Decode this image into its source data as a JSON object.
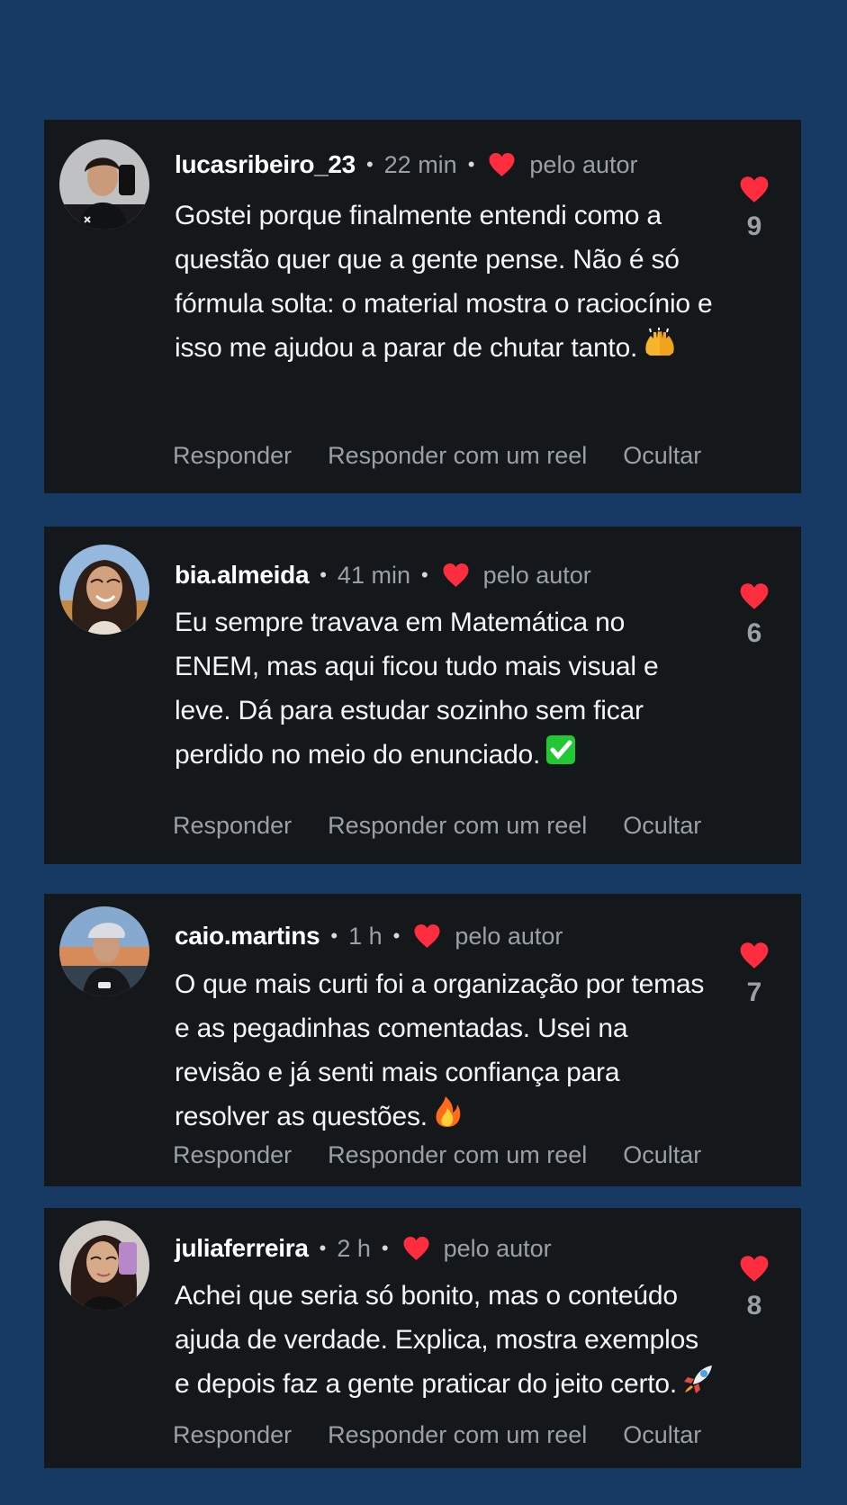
{
  "colors": {
    "background": "#173a65",
    "card": "#15181b",
    "heart": "#ff2d3d",
    "muted_text": "#9aa0a6",
    "text": "#f4f5f6"
  },
  "comments": [
    {
      "username": "lucasribeiro_23",
      "time": "22 min",
      "author_like_label": "pelo autor",
      "text": "Gostei porque finalmente entendi como a questão quer que a gente pense. Não é só fórmula solta: o material mostra o raciocínio e isso me ajudou a parar de chutar tanto.",
      "emoji": "raising-hands",
      "likes": "9",
      "actions": [
        "Responder",
        "Responder com um reel",
        "Ocultar"
      ]
    },
    {
      "username": "bia.almeida",
      "time": "41 min",
      "author_like_label": "pelo autor",
      "text": "Eu sempre travava em Matemática no ENEM, mas aqui ficou tudo mais visual e leve. Dá para estudar sozinho sem ficar perdido no meio do enunciado.",
      "emoji": "check-mark",
      "likes": "6",
      "actions": [
        "Responder",
        "Responder com um reel",
        "Ocultar"
      ]
    },
    {
      "username": "caio.martins",
      "time": "1 h",
      "author_like_label": "pelo autor",
      "text": "O que mais curti foi a organização por temas e as pegadinhas comentadas. Usei na revisão e já senti mais confiança para resolver as questões.",
      "emoji": "fire",
      "likes": "7",
      "actions": [
        "Responder",
        "Responder com um reel",
        "Ocultar"
      ]
    },
    {
      "username": "juliaferreira",
      "time": "2 h",
      "author_like_label": "pelo autor",
      "text": "Achei que seria só bonito, mas o conteúdo ajuda de verdade. Explica, mostra exemplos e depois faz a gente praticar do jeito certo.",
      "emoji": "rocket",
      "likes": "8",
      "actions": [
        "Responder",
        "Responder com um reel",
        "Ocultar"
      ]
    }
  ]
}
